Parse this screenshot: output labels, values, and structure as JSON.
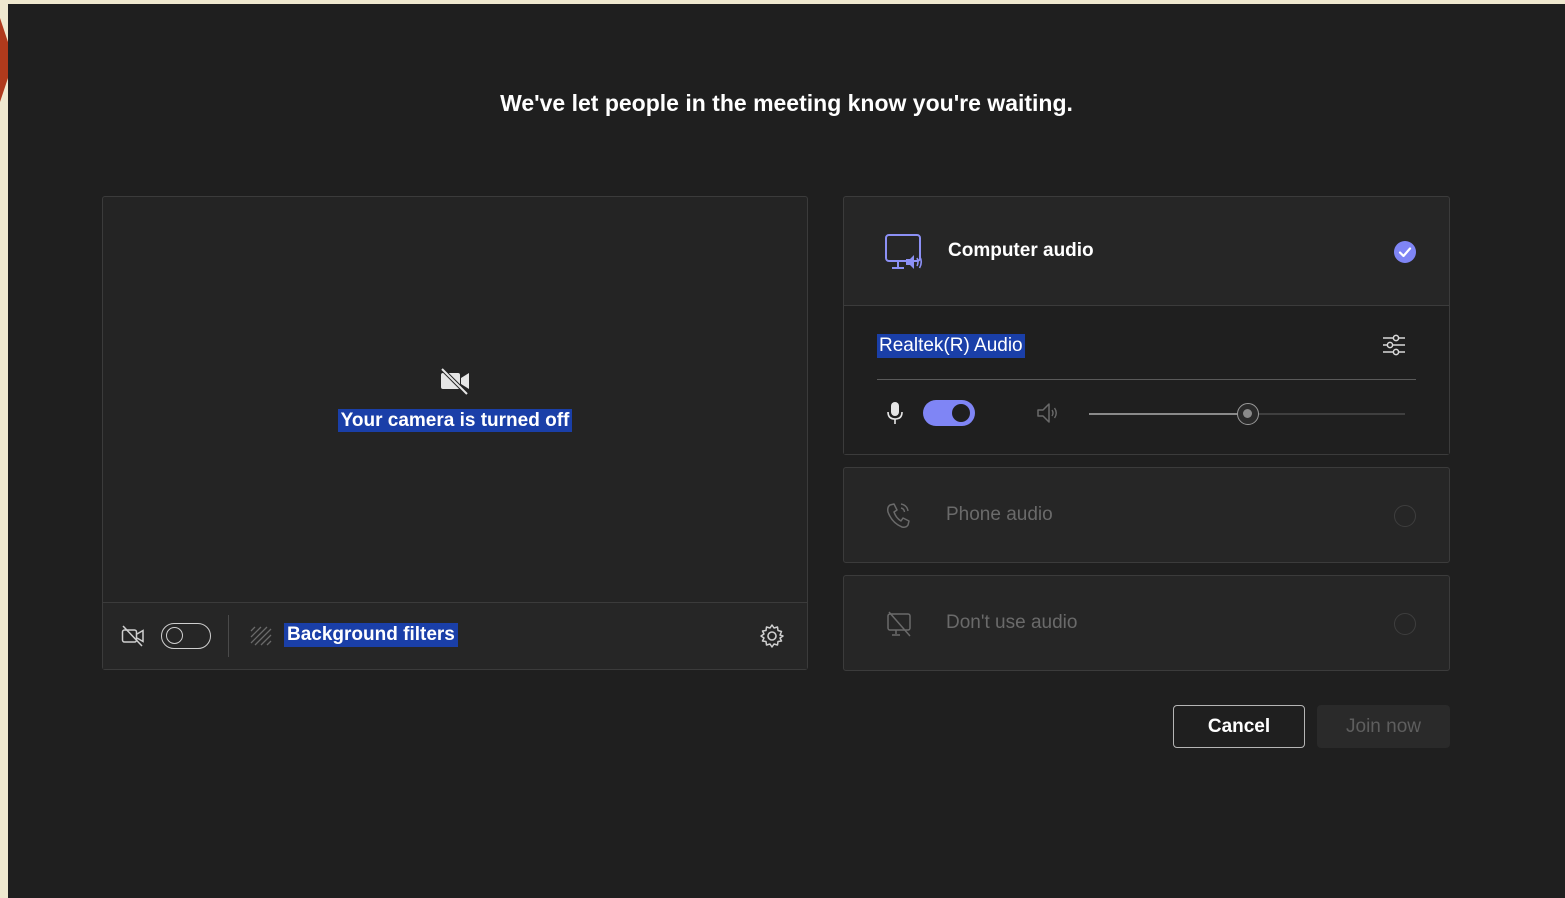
{
  "header": {
    "title": "We've let people in the meeting know you're waiting."
  },
  "video": {
    "camera_off_text": "Your camera is turned off",
    "camera_toggle_on": false,
    "background_filters_label": "Background filters"
  },
  "audio": {
    "computer_audio": {
      "label": "Computer audio",
      "selected": true,
      "device_name": "Realtek(R) Audio",
      "mic_enabled": true,
      "speaker_volume": 0.5
    },
    "phone_audio": {
      "label": "Phone audio",
      "selected": false
    },
    "no_audio": {
      "label": "Don't use audio",
      "selected": false
    }
  },
  "actions": {
    "cancel_label": "Cancel",
    "join_label": "Join now"
  },
  "colors": {
    "accent": "#7f85f5",
    "selection": "#1a3fa8",
    "background": "#1f1f1f"
  }
}
